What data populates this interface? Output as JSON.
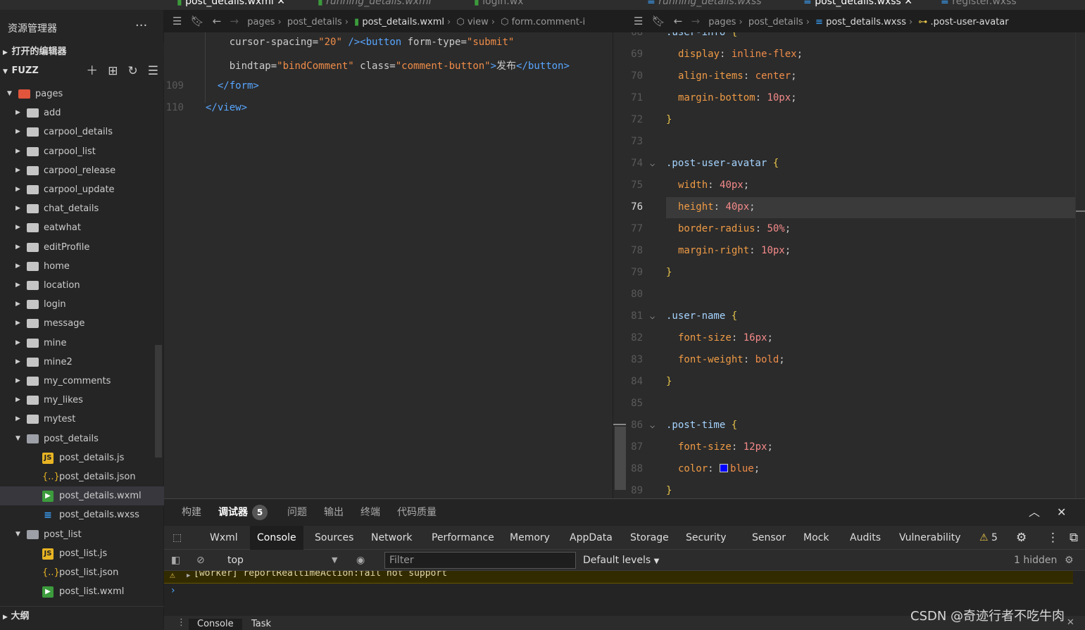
{
  "sidebar": {
    "title": "资源管理器",
    "more": "···",
    "open_editors": "打开的编辑器",
    "project": "FUZZ",
    "outline": "大纲",
    "tree": [
      {
        "label": "pages",
        "type": "folder-open",
        "depth": 0
      },
      {
        "label": "add",
        "type": "folder",
        "depth": 1
      },
      {
        "label": "carpool_details",
        "type": "folder",
        "depth": 1
      },
      {
        "label": "carpool_list",
        "type": "folder",
        "depth": 1
      },
      {
        "label": "carpool_release",
        "type": "folder",
        "depth": 1
      },
      {
        "label": "carpool_update",
        "type": "folder",
        "depth": 1
      },
      {
        "label": "chat_details",
        "type": "folder",
        "depth": 1
      },
      {
        "label": "eatwhat",
        "type": "folder",
        "depth": 1
      },
      {
        "label": "editProfile",
        "type": "folder",
        "depth": 1
      },
      {
        "label": "home",
        "type": "folder",
        "depth": 1
      },
      {
        "label": "location",
        "type": "folder",
        "depth": 1
      },
      {
        "label": "login",
        "type": "folder",
        "depth": 1
      },
      {
        "label": "message",
        "type": "folder",
        "depth": 1
      },
      {
        "label": "mine",
        "type": "folder",
        "depth": 1
      },
      {
        "label": "mine2",
        "type": "folder",
        "depth": 1
      },
      {
        "label": "my_comments",
        "type": "folder",
        "depth": 1
      },
      {
        "label": "my_likes",
        "type": "folder",
        "depth": 1
      },
      {
        "label": "mytest",
        "type": "folder",
        "depth": 1
      },
      {
        "label": "post_details",
        "type": "folder-open",
        "depth": 1
      },
      {
        "label": "post_details.js",
        "type": "js",
        "depth": 2
      },
      {
        "label": "post_details.json",
        "type": "json",
        "depth": 2
      },
      {
        "label": "post_details.wxml",
        "type": "wxml",
        "depth": 2,
        "selected": true
      },
      {
        "label": "post_details.wxss",
        "type": "wxss",
        "depth": 2
      },
      {
        "label": "post_list",
        "type": "folder-open",
        "depth": 1
      },
      {
        "label": "post_list.js",
        "type": "js",
        "depth": 2
      },
      {
        "label": "post_list.json",
        "type": "json",
        "depth": 2
      },
      {
        "label": "post_list.wxml",
        "type": "wxml",
        "depth": 2
      }
    ]
  },
  "tabs": [
    {
      "label": "post_details.wxml",
      "active": true
    },
    {
      "label": "running_details.wxml",
      "italic": true
    },
    {
      "label": "login.wx"
    },
    {
      "label": "running_details.wxss",
      "italic": true
    },
    {
      "label": "post_details.wxss",
      "active": true
    },
    {
      "label": "register.wxss"
    }
  ],
  "breadcrumb_left": [
    "pages",
    "post_details",
    "post_details.wxml",
    "view",
    "form.comment-i"
  ],
  "breadcrumb_right": [
    "pages",
    "post_details",
    "post_details.wxss",
    ".post-user-avatar"
  ],
  "left_editor": {
    "lines": [
      {
        "n": "",
        "html": "    cursor-spacing=<s>\"20\"</s> <t>/></t><t>&lt;button</t> form-type=<s>\"submit\"</s>"
      },
      {
        "n": "",
        "html": "    bindtap=<s>\"bindComment\"</s> class=<s>\"comment-button\"</s><t>></t>发布<t>&lt;/button></t>"
      },
      {
        "n": "109",
        "html": "  <t>&lt;/form></t>"
      },
      {
        "n": "110",
        "html": "<t>&lt;/view></t>"
      }
    ]
  },
  "right_editor": {
    "current_line": "76",
    "lines": [
      {
        "n": "68",
        "text": ".user-info {"
      },
      {
        "n": "69",
        "text": "display: inline-flex;"
      },
      {
        "n": "70",
        "text": "align-items: center;"
      },
      {
        "n": "71",
        "text": "margin-bottom: 10px;"
      },
      {
        "n": "72",
        "text": "}"
      },
      {
        "n": "73",
        "text": ""
      },
      {
        "n": "74",
        "text": ".post-user-avatar {"
      },
      {
        "n": "75",
        "text": "width: 40px;"
      },
      {
        "n": "76",
        "text": "height: 40px;"
      },
      {
        "n": "77",
        "text": "border-radius: 50%;"
      },
      {
        "n": "78",
        "text": "margin-right: 10px;"
      },
      {
        "n": "79",
        "text": "}"
      },
      {
        "n": "80",
        "text": ""
      },
      {
        "n": "81",
        "text": ".user-name {"
      },
      {
        "n": "82",
        "text": "font-size: 16px;"
      },
      {
        "n": "83",
        "text": "font-weight: bold;"
      },
      {
        "n": "84",
        "text": "}"
      },
      {
        "n": "85",
        "text": ""
      },
      {
        "n": "86",
        "text": ".post-time {"
      },
      {
        "n": "87",
        "text": "font-size: 12px;"
      },
      {
        "n": "88",
        "text": "color: blue;"
      },
      {
        "n": "89",
        "text": "}"
      }
    ]
  },
  "panel": {
    "tabs": [
      "构建",
      "调试器",
      "问题",
      "输出",
      "终端",
      "代码质量"
    ],
    "debugger_badge": "5",
    "devtools_tabs": [
      "Wxml",
      "Console",
      "Sources",
      "Network",
      "Performance",
      "Memory",
      "AppData",
      "Storage",
      "Security",
      "Sensor",
      "Mock",
      "Audits",
      "Vulnerability"
    ],
    "warning_count": "5",
    "context": "top",
    "filter_placeholder": "Filter",
    "levels": "Default levels",
    "hidden": "1 hidden",
    "warning_text": "[worker] reportRealtimeAction:fail not support",
    "bottom_tabs": [
      "Console",
      "Task"
    ]
  },
  "watermark": "CSDN @奇迹行者不吃牛肉",
  "colors": {
    "accent": "#58a6ff",
    "swatch_blue": "#0000ff"
  }
}
